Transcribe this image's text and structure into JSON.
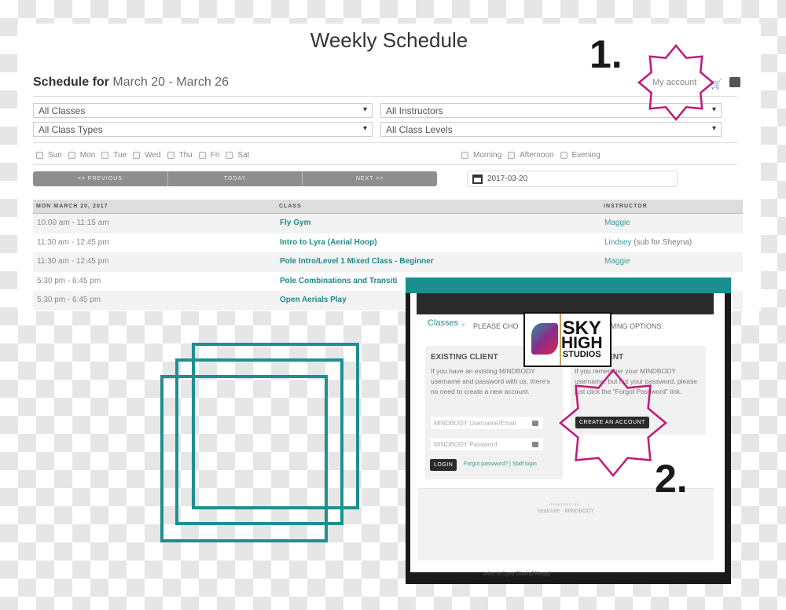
{
  "schedule": {
    "title": "Weekly Schedule",
    "schedule_for": "Schedule for",
    "date_range": "March 20 - March 26",
    "my_account": "My account",
    "filters": {
      "classes": "All Classes",
      "instructors": "All Instructors",
      "class_types": "All Class Types",
      "class_levels": "All Class Levels"
    },
    "days": [
      "Sun",
      "Mon",
      "Tue",
      "Wed",
      "Thu",
      "Fri",
      "Sat"
    ],
    "times_of_day": [
      "Morning",
      "Afternoon",
      "Evening"
    ],
    "nav": {
      "previous": "<< PREVIOUS",
      "today": "TODAY",
      "next": "NEXT >>"
    },
    "date": "2017-03-20",
    "table": {
      "headers": [
        "MON MARCH 20, 2017",
        "CLASS",
        "INSTRUCTOR"
      ],
      "rows": [
        {
          "time": "10:00 am - 11:15 am",
          "class": "Fly Gym",
          "instructor": "Maggie",
          "note": ""
        },
        {
          "time": "11:30 am - 12:45 pm",
          "class": "Intro to Lyra (Aerial Hoop)",
          "instructor": "Lindsey",
          "note": "(sub for Sheyna)"
        },
        {
          "time": "11:30 am - 12:45 pm",
          "class": "Pole Intro/Level 1 Mixed Class - Beginner",
          "instructor": "Maggie",
          "note": ""
        },
        {
          "time": "5:30 pm - 6:45 pm",
          "class": "Pole Combinations and Transiti",
          "instructor": "",
          "note": ""
        },
        {
          "time": "5:30 pm - 6:45 pm",
          "class": "Open Aerials Play",
          "instructor": "",
          "note": ""
        }
      ]
    }
  },
  "annotations": {
    "step1": "1.",
    "step2": "2.",
    "accent": "#c2187b",
    "teal": "#1e9090"
  },
  "popup": {
    "classes": "Classes",
    "please_left": "PLEASE CHO",
    "please_right": "WING OPTIONS:",
    "logo": {
      "line1": "SKY",
      "line2": "HIGH",
      "line3": "STUDIOS"
    },
    "existing": {
      "title": "EXISTING CLIENT",
      "text": "If you have an existing MINDBODY username and password with us, there's no need to create a new account.",
      "username_placeholder": "MINDBODY Username/Email",
      "password_placeholder": "MINDBODY Password",
      "login": "LOGIN",
      "forgot": "Forgot password?",
      "sep": "|",
      "staff": "Staff login"
    },
    "new": {
      "title": "NEW CLIENT",
      "text": "If you remember your MINDBODY username, but not your password, please just click the \"Forgot Password\" link.",
      "create": "CREATE AN ACCOUNT"
    },
    "powered": "POWERED BY:",
    "powered_brands": "healcode · MINDBODY",
    "behind_text": "Intro to Lyra (Aerial Hoop)"
  }
}
